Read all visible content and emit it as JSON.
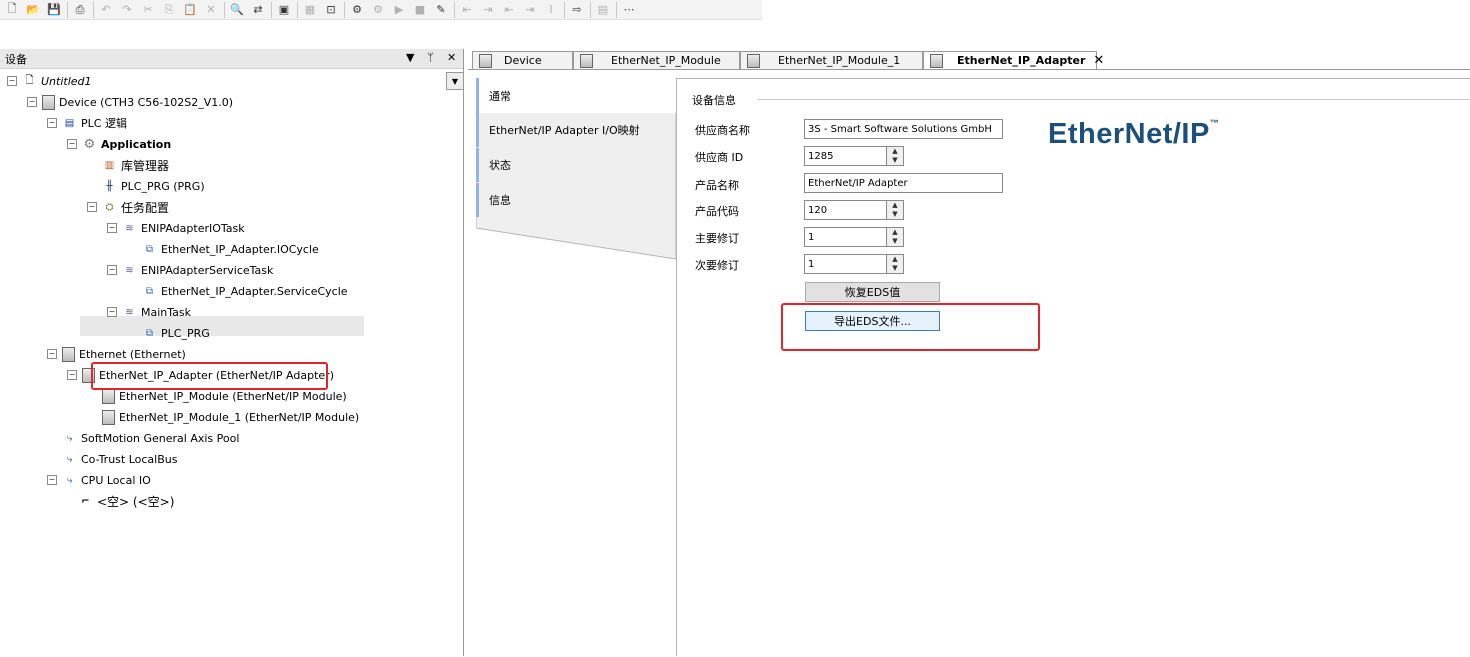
{
  "toolbar": {
    "icons": [
      "new-icon",
      "open-icon",
      "save-icon",
      "print-icon",
      "undo-icon",
      "redo-icon",
      "cut-icon",
      "copy-icon",
      "paste-icon",
      "delete-icon",
      "find-icon",
      "replace-icon",
      "window-icon",
      "grid-icon",
      "build-icon",
      "login-icon",
      "run-icon",
      "stop-icon",
      "reset-icon",
      "step-over-icon",
      "step-into-icon",
      "step-out-icon",
      "breakpoint-icon",
      "next-icon",
      "monitor-icon",
      "more-icon"
    ]
  },
  "left_panel": {
    "title": "设备",
    "pin_glyph": "▼",
    "dock_glyph": "ᛘ",
    "close_glyph": "✕"
  },
  "tree": [
    {
      "label": "Untitled1"
    },
    {
      "label": "Device (CTH3 C56-102S2_V1.0)"
    },
    {
      "label": "PLC 逻辑"
    },
    {
      "label": "Application"
    },
    {
      "label": "库管理器"
    },
    {
      "label": "PLC_PRG (PRG)"
    },
    {
      "label": "任务配置"
    },
    {
      "label": "ENIPAdapterIOTask"
    },
    {
      "label": "EtherNet_IP_Adapter.IOCycle"
    },
    {
      "label": "ENIPAdapterServiceTask"
    },
    {
      "label": "EtherNet_IP_Adapter.ServiceCycle"
    },
    {
      "label": "MainTask"
    },
    {
      "label": "PLC_PRG"
    },
    {
      "label": "Ethernet (Ethernet)"
    },
    {
      "label": "EtherNet_IP_Adapter (EtherNet/IP Adapter)"
    },
    {
      "label": "EtherNet_IP_Module (EtherNet/IP Module)"
    },
    {
      "label": "EtherNet_IP_Module_1 (EtherNet/IP Module)"
    },
    {
      "label": "SoftMotion General Axis Pool"
    },
    {
      "label": "Co-Trust LocalBus"
    },
    {
      "label": "CPU Local IO"
    },
    {
      "label": "<空> (<空>)"
    }
  ],
  "tabs": [
    {
      "label": "Device"
    },
    {
      "label": "EtherNet_IP_Module"
    },
    {
      "label": "EtherNet_IP_Module_1"
    },
    {
      "label": "EtherNet_IP_Adapter",
      "close": "✕"
    }
  ],
  "subnav": [
    {
      "label": "通常"
    },
    {
      "label": "EtherNet/IP Adapter I/O映射"
    },
    {
      "label": "状态"
    },
    {
      "label": "信息"
    }
  ],
  "device_info": {
    "section_title": "设备信息",
    "vendor_name_label": "供应商名称",
    "vendor_name": "3S - Smart Software Solutions GmbH",
    "vendor_id_label": "供应商 ID",
    "vendor_id": "1285",
    "product_name_label": "产品名称",
    "product_name": "EtherNet/IP Adapter",
    "product_code_label": "产品代码",
    "product_code": "120",
    "major_rev_label": "主要修订",
    "major_rev": "1",
    "minor_rev_label": "次要修订",
    "minor_rev": "1",
    "restore_eds_label": "恢复EDS值",
    "export_eds_label": "导出EDS文件..."
  },
  "logo": {
    "text_a": "Ether",
    "text_b": "Net/IP",
    "tm": "™",
    "color": "#1c4f7a"
  },
  "accent": {
    "highlight": "#e0262a",
    "nav_bar": "#8fb5e0"
  }
}
